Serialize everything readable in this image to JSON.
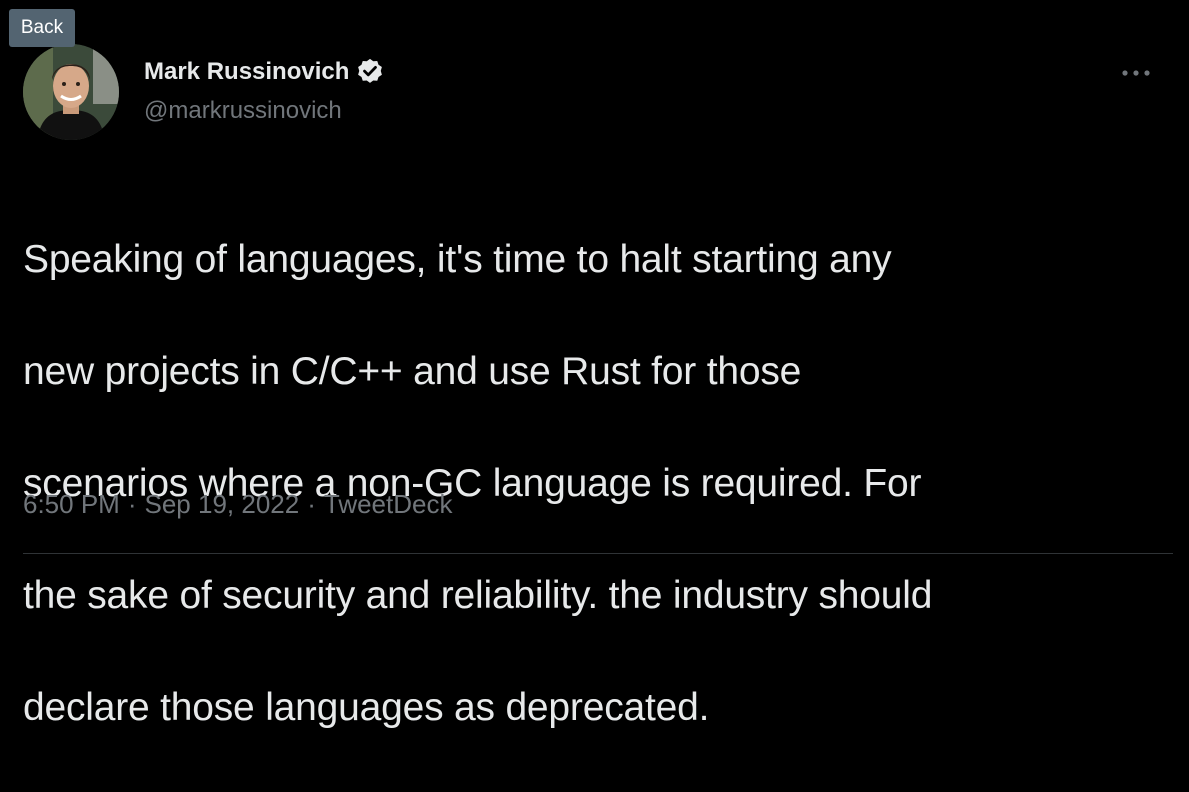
{
  "nav": {
    "back_label": "Back"
  },
  "author": {
    "display_name": "Mark Russinovich",
    "handle": "@markrussinovich",
    "verified": true
  },
  "tweet": {
    "text_lines": [
      "Speaking of languages, it's time to halt starting any",
      "new projects in C/C++ and use Rust for those",
      "scenarios where a non-GC language is required. For",
      "the sake of security and reliability. the industry should",
      "declare those languages as deprecated."
    ],
    "time": "6:50 PM",
    "date": "Sep 19, 2022",
    "source": "TweetDeck",
    "separator": "·"
  },
  "icons": {
    "verified": "verified-badge-icon",
    "more": "more-options-icon"
  },
  "colors": {
    "background": "#000000",
    "text_primary": "#e7e9ea",
    "text_secondary": "#71767b",
    "back_button_bg": "#536471",
    "divider": "#2f3336"
  }
}
